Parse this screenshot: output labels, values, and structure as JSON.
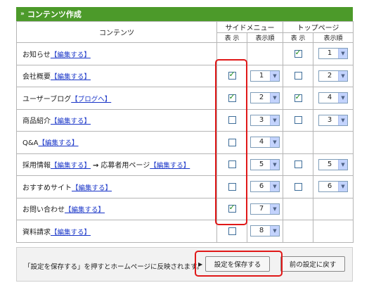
{
  "panel": {
    "title_icon": "»",
    "title": "コンテンツ作成"
  },
  "headers": {
    "content": "コンテンツ",
    "side_menu": "サイドメニュー",
    "top_page": "トップページ",
    "show": "表 示",
    "order": "表示順"
  },
  "rows": [
    {
      "name": "お知らせ",
      "link": "【編集する】",
      "side_show": null,
      "side_order": null,
      "top_show": true,
      "top_order": "1"
    },
    {
      "name": "会社概要",
      "link": "【編集する】",
      "side_show": true,
      "side_order": "1",
      "top_show": false,
      "top_order": "2"
    },
    {
      "name": "ユーザーブログ",
      "link": "【ブログへ】",
      "side_show": true,
      "side_order": "2",
      "top_show": true,
      "top_order": "4"
    },
    {
      "name": "商品紹介",
      "link": "【編集する】",
      "side_show": false,
      "side_order": "3",
      "top_show": false,
      "top_order": "3"
    },
    {
      "name": "Q&A",
      "link": "【編集する】",
      "side_show": false,
      "side_order": "4",
      "top_show": null,
      "top_order": null
    },
    {
      "name": "採用情報",
      "link": "【編集する】",
      "arrow": "→",
      "name2": "応募者用ページ",
      "link2": "【編集する】",
      "side_show": false,
      "side_order": "5",
      "top_show": false,
      "top_order": "5"
    },
    {
      "name": "おすすめサイト",
      "link": "【編集する】",
      "side_show": false,
      "side_order": "6",
      "top_show": false,
      "top_order": "6"
    },
    {
      "name": "お問い合わせ",
      "link": "【編集する】",
      "side_show": true,
      "side_order": "7",
      "top_show": null,
      "top_order": null
    },
    {
      "name": "資料請求",
      "link": "【編集する】",
      "side_show": false,
      "side_order": "8",
      "top_show": null,
      "top_order": null
    }
  ],
  "footer": {
    "message": "「設定を保存する」を押すとホームページに反映されます。",
    "pointer": "▶",
    "save_label": "設定を保存する",
    "revert_label": "前の設定に戻す"
  },
  "colors": {
    "title_bar": "#4c9a2a",
    "highlight": "#e01818",
    "link": "#1a36c8"
  }
}
